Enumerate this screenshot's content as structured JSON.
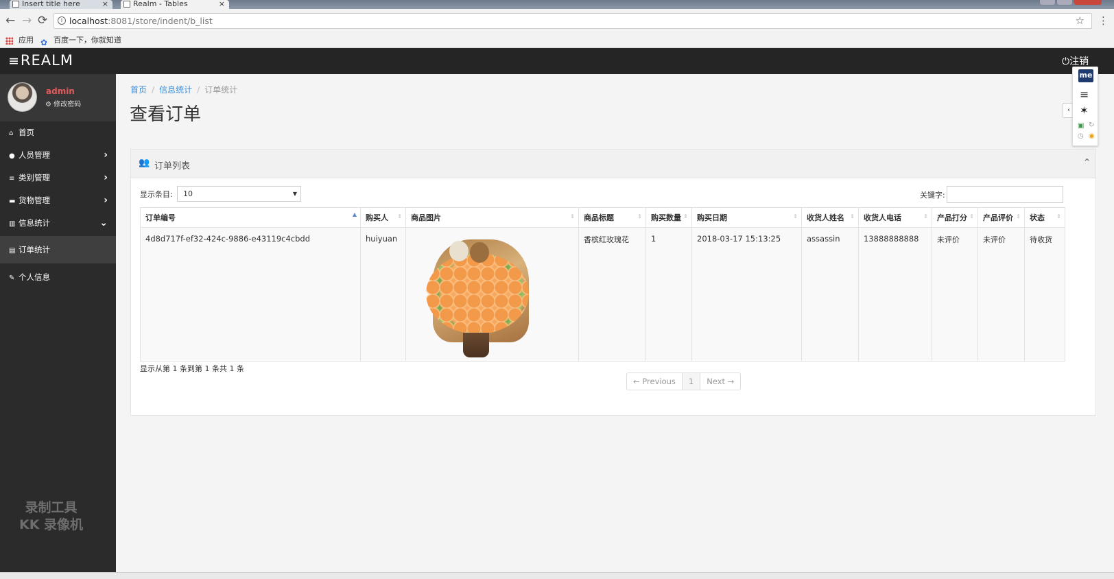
{
  "browser": {
    "tabs": [
      {
        "title": "Insert title here",
        "close": "×"
      },
      {
        "title": "Realm - Tables",
        "close": "×"
      }
    ],
    "url_host": "localhost",
    "url_rest": ":8081/store/indent/b_list",
    "bookmarks": [
      "应用",
      "百度一下，你就知道"
    ],
    "back_icon": "←",
    "forward_icon": "→",
    "reload_icon": "⟳",
    "star_icon": "☆",
    "menu_icon": "⋮"
  },
  "header": {
    "brand": "REALM",
    "logout": "注销"
  },
  "sidebar": {
    "user": {
      "name": "admin",
      "change_password": "修改密码"
    },
    "items": [
      {
        "label": "首页",
        "icon": "home-icon",
        "glyph": "⌂"
      },
      {
        "label": "人员管理",
        "icon": "user-icon",
        "glyph": "●",
        "arrow": "›"
      },
      {
        "label": "类别管理",
        "icon": "list-icon",
        "glyph": "≡",
        "arrow": "›"
      },
      {
        "label": "货物管理",
        "icon": "cart-icon",
        "glyph": "▬",
        "arrow": "›"
      },
      {
        "label": "信息统计",
        "icon": "chart-icon",
        "glyph": "▥",
        "arrow": "⌄"
      },
      {
        "label": "订单统计",
        "icon": "table-icon",
        "glyph": "▤"
      },
      {
        "label": "个人信息",
        "icon": "edit-icon",
        "glyph": "✎"
      }
    ],
    "watermark_line1": "录制工具",
    "watermark_line2": "KK 录像机"
  },
  "main": {
    "breadcrumb": [
      "首页",
      "信息统计",
      "订单统计"
    ],
    "title": "查看订单",
    "panel_title": "订单列表",
    "length_label": "显示条目:",
    "length_value": "10",
    "search_label": "关键字:",
    "search_value": "",
    "columns": [
      "订单编号",
      "购买人",
      "商品图片",
      "商品标题",
      "购买数量",
      "购买日期",
      "收货人姓名",
      "收货人电话",
      "产品打分",
      "产品评价",
      "状态"
    ],
    "rows": [
      {
        "id": "4d8d717f-ef32-424c-9886-e43119c4cbdd",
        "buyer": "huiyuan",
        "title": "香槟红玫瑰花",
        "qty": "1",
        "date": "2018-03-17 15:13:25",
        "receiver": "assassin",
        "phone": "13888888888",
        "score": "未评价",
        "review": "未评价",
        "status": "待收货"
      }
    ],
    "info": "显示从第 1 条到第 1 条共 1 条",
    "pager": {
      "prev": "← Previous",
      "page": "1",
      "next": "Next →"
    }
  },
  "tools": {
    "me": "me"
  }
}
